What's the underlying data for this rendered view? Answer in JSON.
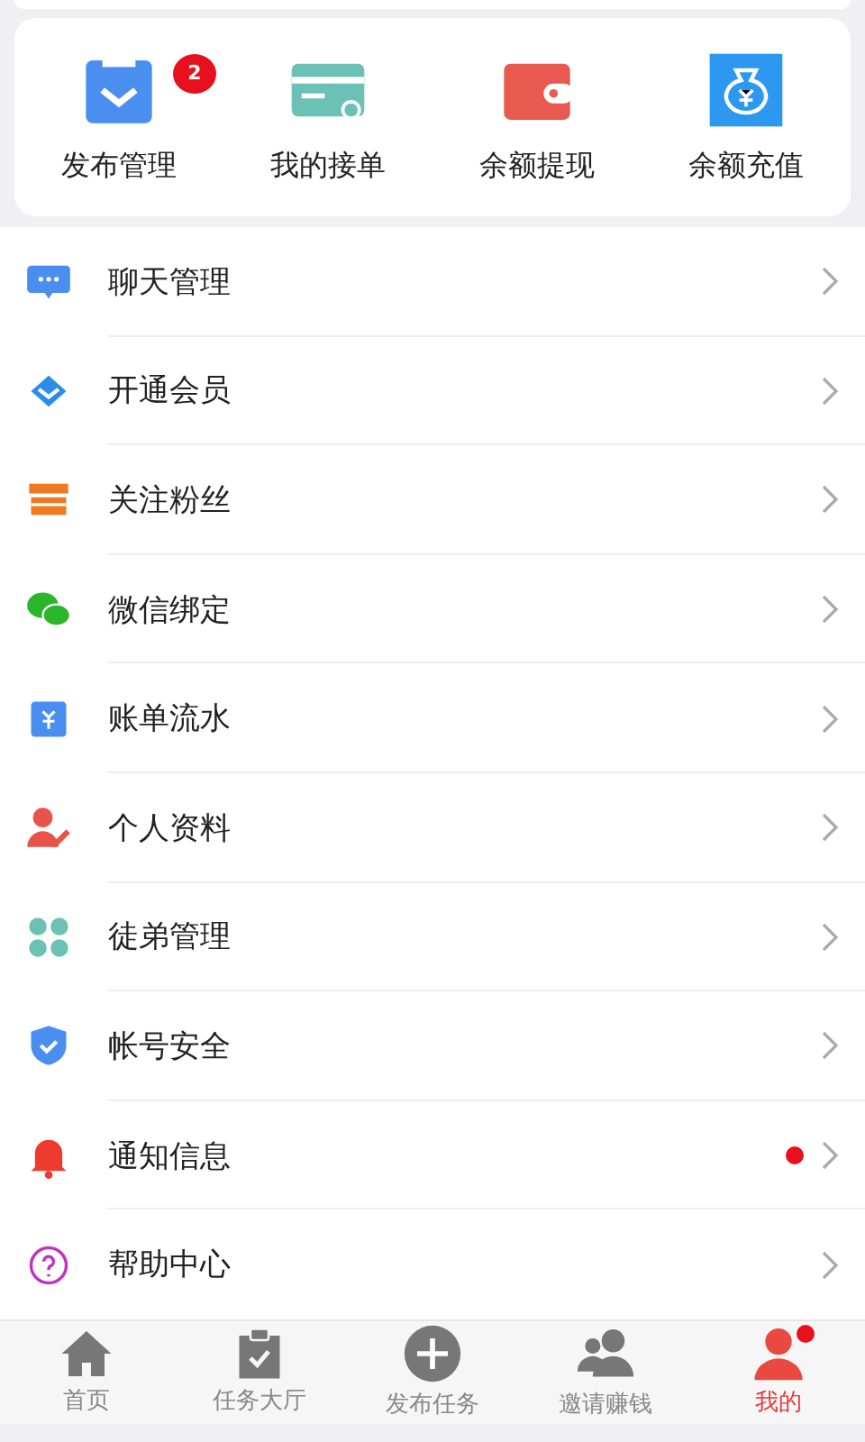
{
  "quick_actions": [
    {
      "label": "发布管理",
      "badge": "2"
    },
    {
      "label": "我的接单"
    },
    {
      "label": "余额提现"
    },
    {
      "label": "余额充值"
    }
  ],
  "menu": [
    {
      "label": "聊天管理",
      "dot": false
    },
    {
      "label": "开通会员",
      "dot": false
    },
    {
      "label": "关注粉丝",
      "dot": false
    },
    {
      "label": "微信绑定",
      "dot": false
    },
    {
      "label": "账单流水",
      "dot": false
    },
    {
      "label": "个人资料",
      "dot": false
    },
    {
      "label": "徒弟管理",
      "dot": false
    },
    {
      "label": "帐号安全",
      "dot": false
    },
    {
      "label": "通知信息",
      "dot": true
    },
    {
      "label": "帮助中心",
      "dot": false
    }
  ],
  "tabs": [
    {
      "label": "首页",
      "selected": false,
      "dot": false
    },
    {
      "label": "任务大厅",
      "selected": false,
      "dot": false
    },
    {
      "label": "发布任务",
      "selected": false,
      "dot": false
    },
    {
      "label": "邀请赚钱",
      "selected": false,
      "dot": false
    },
    {
      "label": "我的",
      "selected": true,
      "dot": true
    }
  ]
}
